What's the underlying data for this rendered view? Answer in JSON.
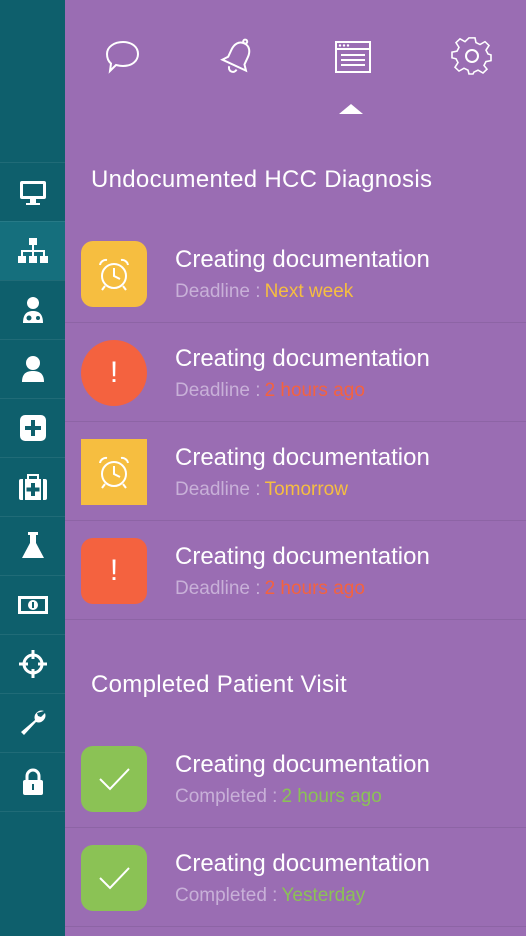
{
  "colors": {
    "sidebar_bg": "#0e5f6c",
    "main_bg": "#9a6db3",
    "amber": "#f6be40",
    "red": "#f4623f",
    "green": "#8bc255"
  },
  "top_icons": [
    "chat-bubble-icon",
    "bell-icon",
    "browser-window-icon",
    "gear-icon"
  ],
  "sidebar": {
    "items": [
      {
        "icon": "monitor-icon"
      },
      {
        "icon": "hierarchy-icon"
      },
      {
        "icon": "doctor-icon"
      },
      {
        "icon": "user-icon"
      },
      {
        "icon": "plus-box-icon"
      },
      {
        "icon": "medical-kit-icon"
      },
      {
        "icon": "flask-icon"
      },
      {
        "icon": "money-icon"
      },
      {
        "icon": "crosshair-icon"
      },
      {
        "icon": "wrench-icon"
      },
      {
        "icon": "lock-icon"
      }
    ]
  },
  "sections": [
    {
      "title": "Undocumented HCC Diagnosis",
      "rows": [
        {
          "title": "Creating documentation",
          "label": "Deadline :",
          "value": "Next week",
          "status": "alarm",
          "color": "amber"
        },
        {
          "title": "Creating documentation",
          "label": "Deadline :",
          "value": "2 hours ago",
          "status": "alert",
          "color": "red"
        },
        {
          "title": "Creating documentation",
          "label": "Deadline :",
          "value": "Tomorrow",
          "status": "alarm",
          "color": "amber"
        },
        {
          "title": "Creating documentation",
          "label": "Deadline :",
          "value": "2 hours ago",
          "status": "alert",
          "color": "red"
        }
      ]
    },
    {
      "title": "Completed Patient Visit",
      "rows": [
        {
          "title": "Creating documentation",
          "label": "Completed :",
          "value": "2 hours ago",
          "status": "done",
          "color": "green"
        },
        {
          "title": "Creating documentation",
          "label": "Completed :",
          "value": "Yesterday",
          "status": "done",
          "color": "green"
        }
      ]
    }
  ],
  "alert_glyph": "!"
}
